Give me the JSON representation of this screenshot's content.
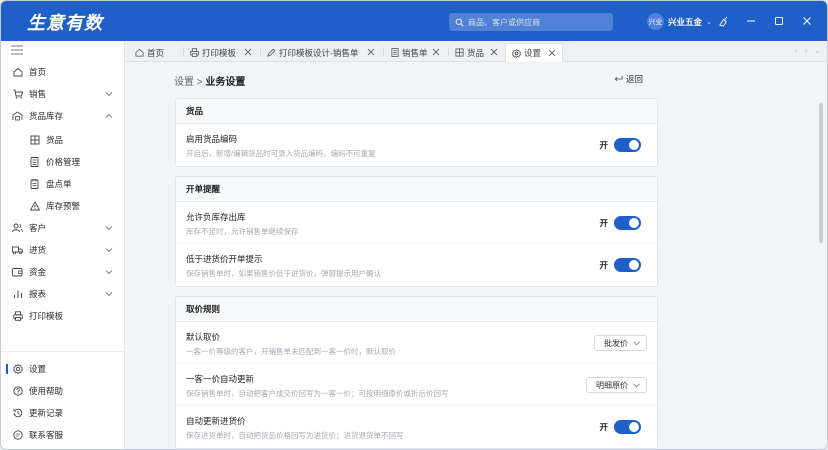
{
  "app": {
    "brand": "生意有数",
    "search_placeholder": "商品、客户或供应商",
    "user_avatar": "兴业",
    "user_name": "兴业五金"
  },
  "sidebar": {
    "items": [
      {
        "label": "首页"
      },
      {
        "label": "销售"
      },
      {
        "label": "货品库存"
      },
      {
        "label": "货品"
      },
      {
        "label": "价格管理"
      },
      {
        "label": "盘点单"
      },
      {
        "label": "库存预警"
      },
      {
        "label": "客户"
      },
      {
        "label": "进货"
      },
      {
        "label": "资金"
      },
      {
        "label": "报表"
      },
      {
        "label": "打印模板"
      }
    ],
    "footer": [
      {
        "label": "设置"
      },
      {
        "label": "使用帮助"
      },
      {
        "label": "更新记录"
      },
      {
        "label": "联系客服"
      }
    ]
  },
  "tabs": [
    {
      "label": "首页"
    },
    {
      "label": "打印模板"
    },
    {
      "label": "打印模板设计-销售单"
    },
    {
      "label": "销售单"
    },
    {
      "label": "货品"
    },
    {
      "label": "设置"
    }
  ],
  "page": {
    "breadcrumb_parent": "设置",
    "breadcrumb_sep": ">",
    "breadcrumb_current": "业务设置",
    "back_label": "返回"
  },
  "sections": [
    {
      "title": "货品",
      "rows": [
        {
          "title": "启用货品编码",
          "desc": "开启后，新增/编辑货品时可录入货品编码，编码不可重复",
          "toggle_label": "开",
          "enabled": true
        }
      ]
    },
    {
      "title": "开单提醒",
      "rows": [
        {
          "title": "允许负库存出库",
          "desc": "库存不足时，允许销售单继续保存",
          "toggle_label": "开",
          "enabled": true
        },
        {
          "title": "低于进货价开单提示",
          "desc": "保存销售单时，如果销售价低于进货价，弹窗提示用户确认",
          "toggle_label": "开",
          "enabled": true
        }
      ]
    },
    {
      "title": "取价规则",
      "rows": [
        {
          "title": "默认取价",
          "desc": "一客一价等级的客户，开销售单未匹配到一客一价时，默认取价",
          "select_value": "批发价"
        },
        {
          "title": "一客一价自动更新",
          "desc": "保存销售单时，自动把客户成交价回写为一客一价；可按明细原价或折后价回写",
          "select_value": "明细原价"
        },
        {
          "title": "自动更新进货价",
          "desc": "保存进货单时，自动把货品价格回写为进货价；进货退货单不回写",
          "toggle_label": "开",
          "enabled": true
        }
      ]
    }
  ],
  "colors": {
    "accent": "#1e5fc8"
  }
}
